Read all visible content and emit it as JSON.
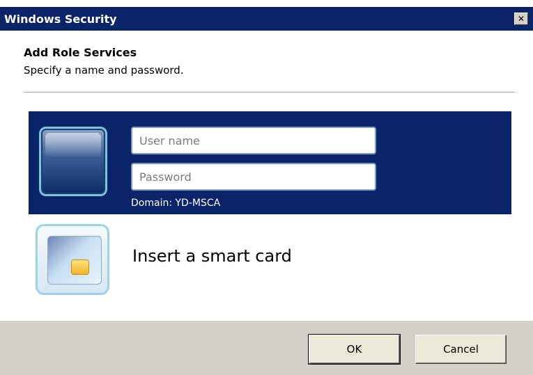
{
  "window": {
    "title": "Windows Security",
    "close_glyph": "✕"
  },
  "header": {
    "title": "Add Role Services",
    "subtitle": "Specify a name and password."
  },
  "credentials": {
    "username_placeholder": "User name",
    "password_placeholder": "Password",
    "domain_text": "Domain: YD-MSCA",
    "user_icon": "user-tile-icon"
  },
  "smartcard": {
    "label": "Insert a smart card",
    "icon": "smart-card-icon"
  },
  "footer": {
    "ok_label": "OK",
    "cancel_label": "Cancel"
  },
  "colors": {
    "title_bar": "#0a246a",
    "selected_panel": "#0a246a",
    "footer": "#d4d0c8"
  }
}
